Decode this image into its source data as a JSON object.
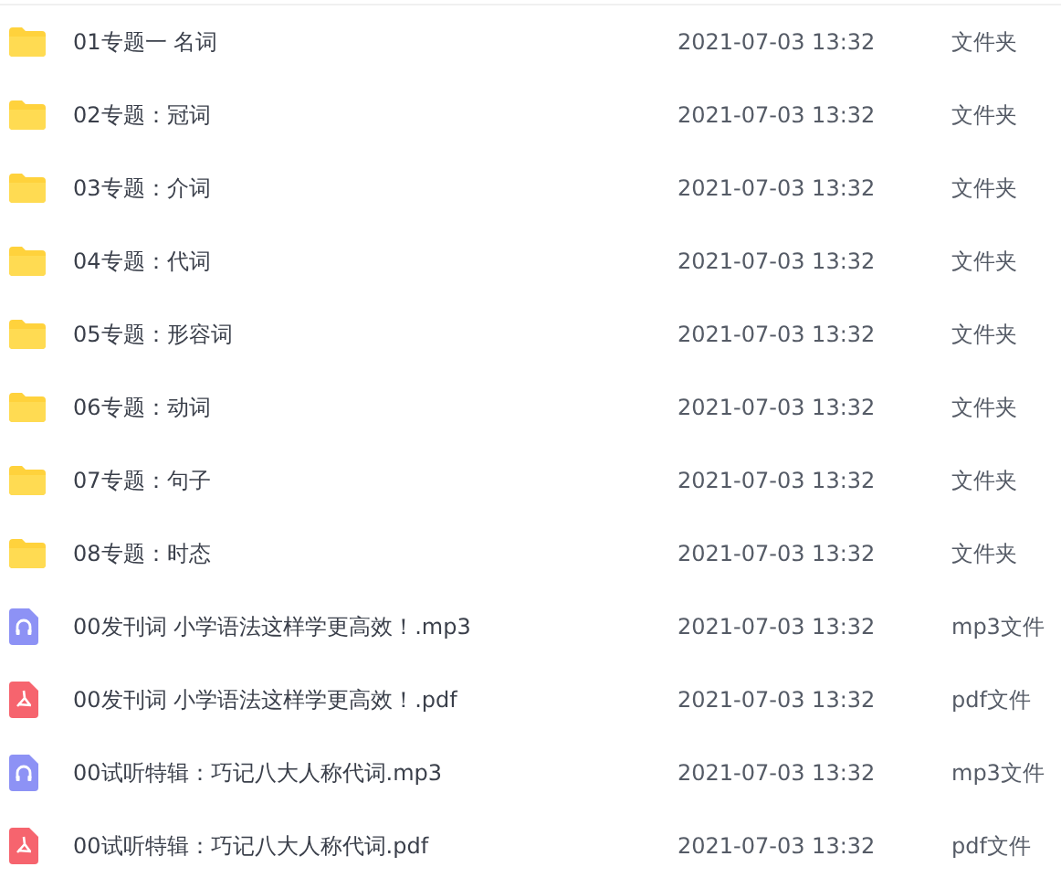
{
  "files": [
    {
      "kind": "folder",
      "name": "01专题一 名词",
      "modified": "2021-07-03 13:32",
      "type": "文件夹"
    },
    {
      "kind": "folder",
      "name": "02专题：冠词",
      "modified": "2021-07-03 13:32",
      "type": "文件夹"
    },
    {
      "kind": "folder",
      "name": "03专题：介词",
      "modified": "2021-07-03 13:32",
      "type": "文件夹"
    },
    {
      "kind": "folder",
      "name": "04专题：代词",
      "modified": "2021-07-03 13:32",
      "type": "文件夹"
    },
    {
      "kind": "folder",
      "name": "05专题：形容词",
      "modified": "2021-07-03 13:32",
      "type": "文件夹"
    },
    {
      "kind": "folder",
      "name": "06专题：动词",
      "modified": "2021-07-03 13:32",
      "type": "文件夹"
    },
    {
      "kind": "folder",
      "name": "07专题：句子",
      "modified": "2021-07-03 13:32",
      "type": "文件夹"
    },
    {
      "kind": "folder",
      "name": "08专题：时态",
      "modified": "2021-07-03 13:32",
      "type": "文件夹"
    },
    {
      "kind": "audio",
      "name": "00发刊词 小学语法这样学更高效！.mp3",
      "modified": "2021-07-03 13:32",
      "type": "mp3文件"
    },
    {
      "kind": "pdf",
      "name": "00发刊词 小学语法这样学更高效！.pdf",
      "modified": "2021-07-03 13:32",
      "type": "pdf文件"
    },
    {
      "kind": "audio",
      "name": "00试听特辑：巧记八大人称代词.mp3",
      "modified": "2021-07-03 13:32",
      "type": "mp3文件"
    },
    {
      "kind": "pdf",
      "name": "00试听特辑：巧记八大人称代词.pdf",
      "modified": "2021-07-03 13:32",
      "type": "pdf文件"
    }
  ]
}
